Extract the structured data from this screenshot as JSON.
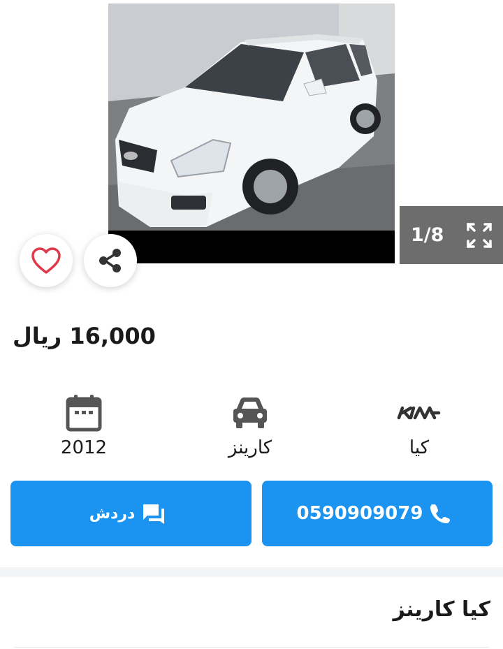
{
  "gallery": {
    "counter": "1/8",
    "icons": {
      "prev": "chevron-left-icon",
      "next": "chevron-right-icon",
      "fullscreen": "expand-icon",
      "favorite": "heart-icon",
      "share": "share-icon"
    }
  },
  "listing": {
    "price": "16,000 ريال",
    "title": "كيا كارينز"
  },
  "specs": {
    "year": "2012",
    "model": "كارينز",
    "make": "كيا"
  },
  "actions": {
    "chat_label": "دردش",
    "phone": "0590909079"
  },
  "colors": {
    "accent": "#1b93f0",
    "counter_bg": "#6d6d6d",
    "heart": "#e0384a"
  }
}
